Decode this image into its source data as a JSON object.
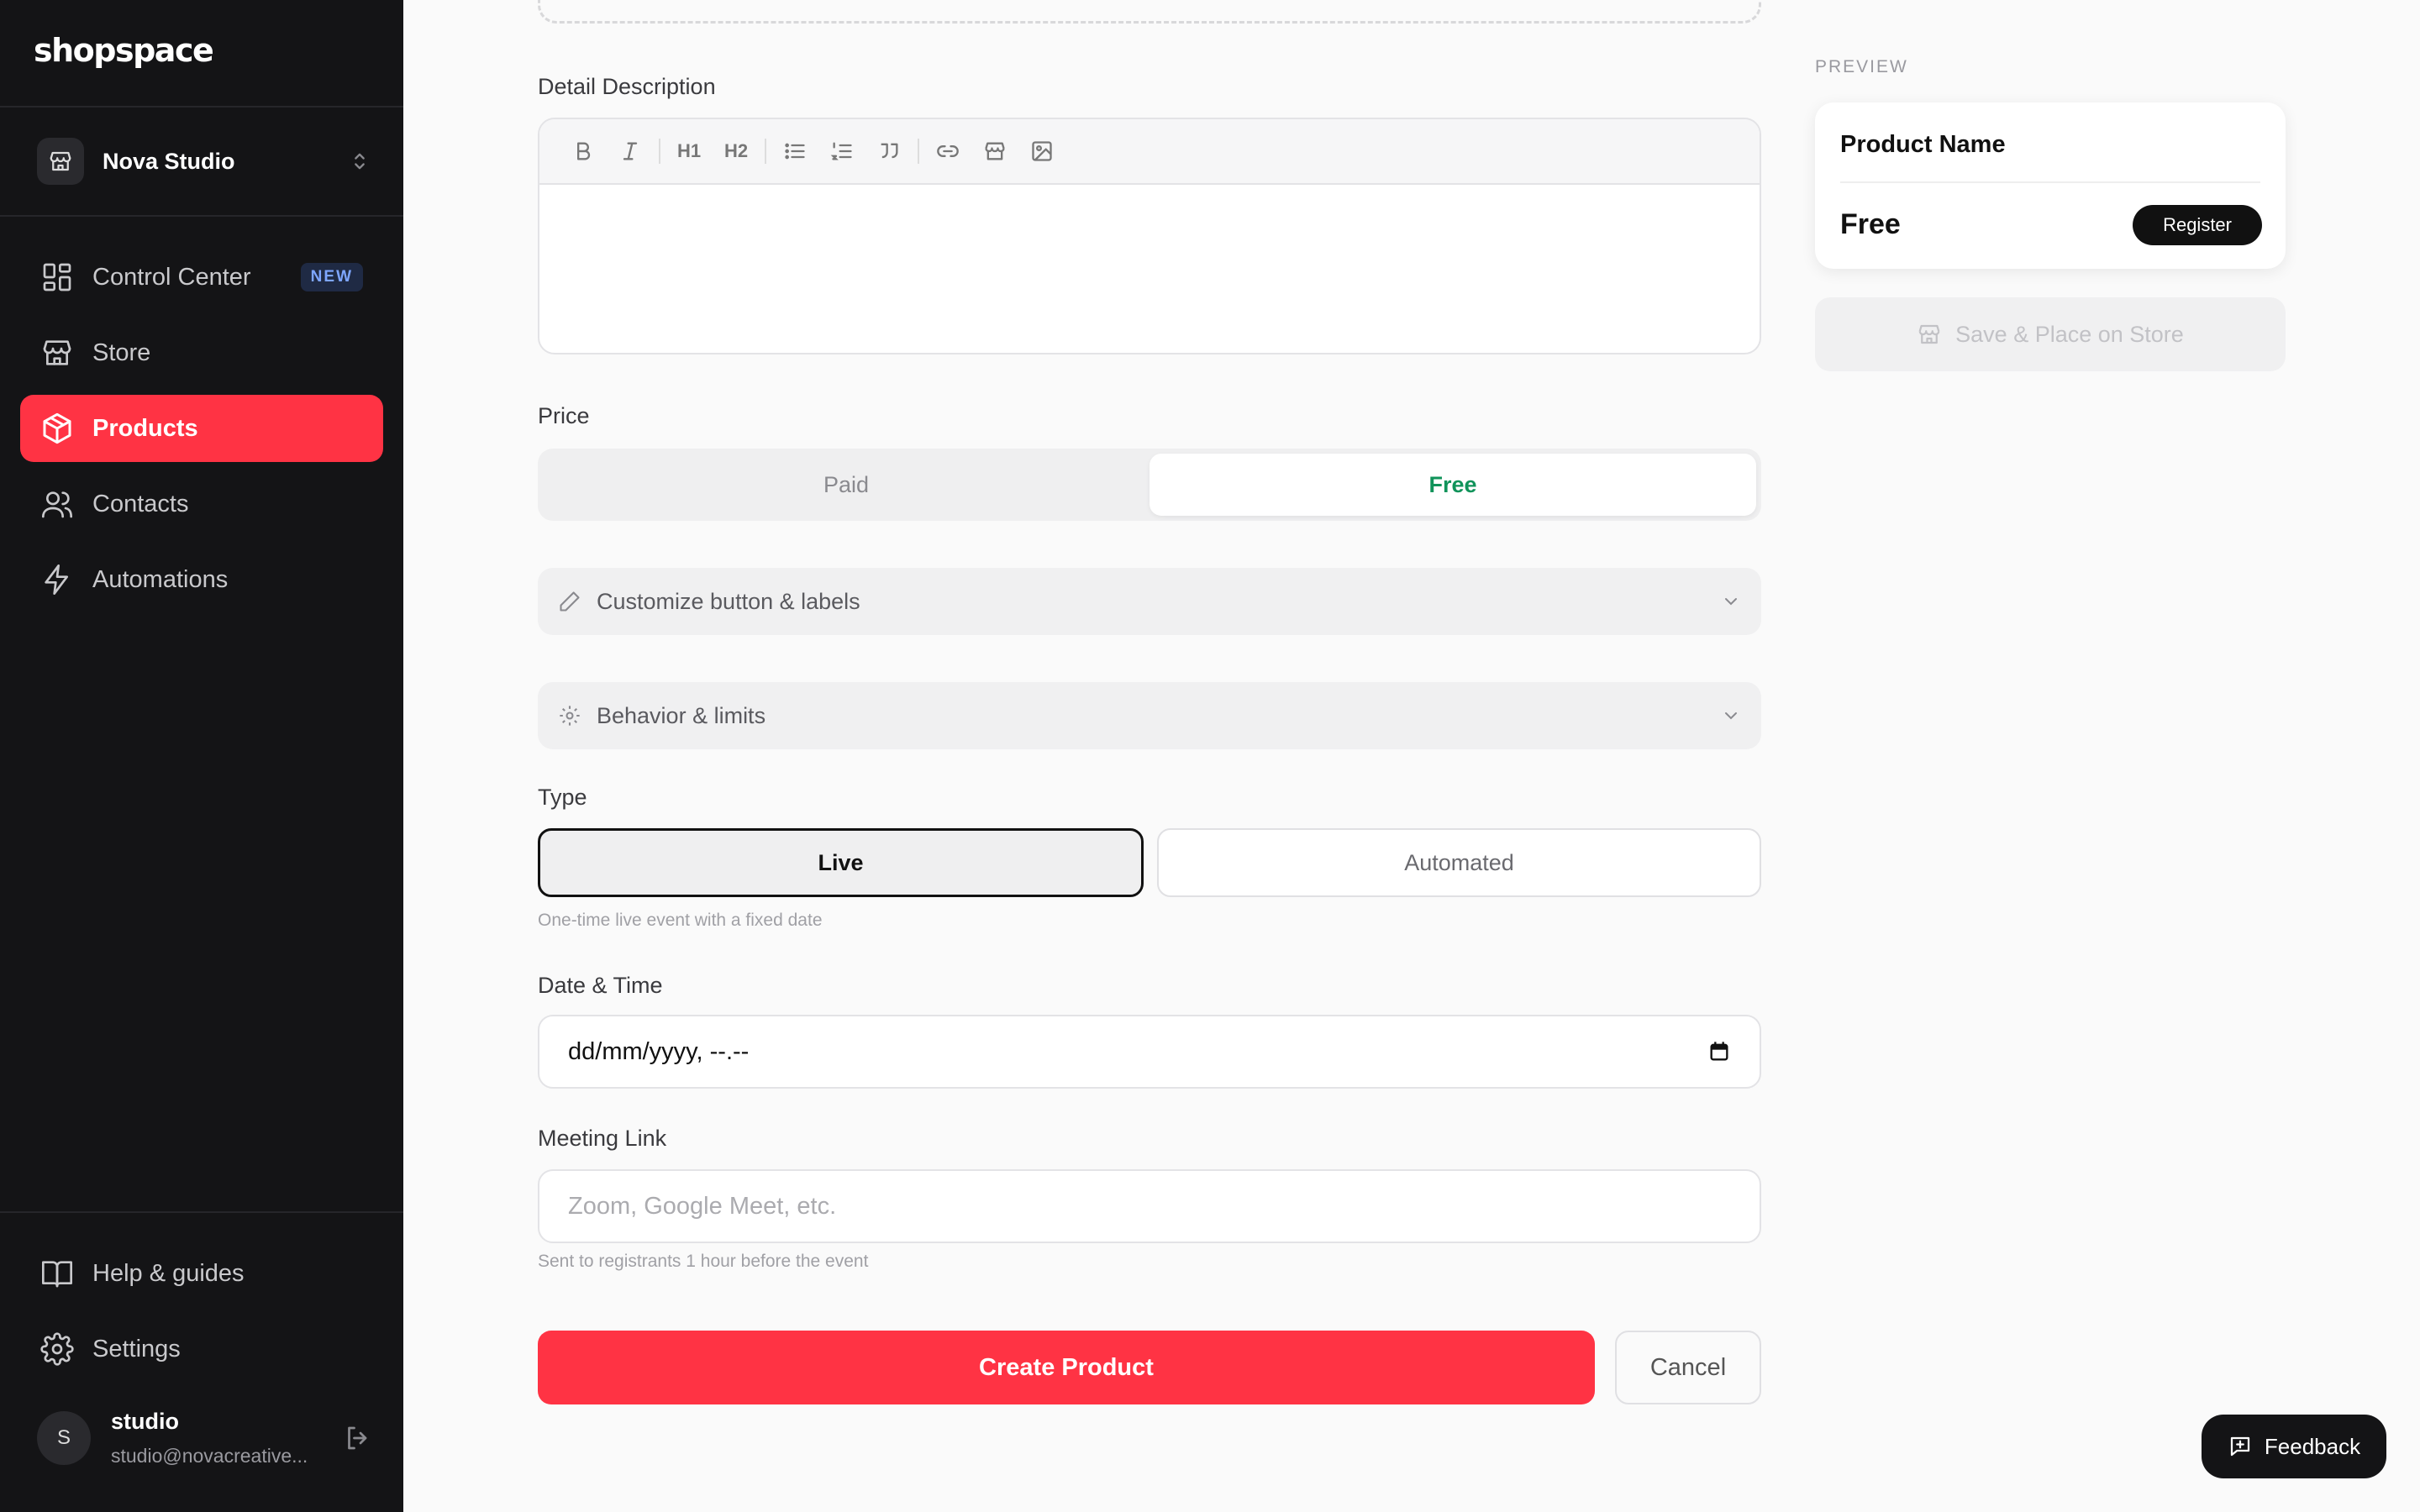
{
  "app": {
    "logo": "shopspace"
  },
  "workspace": {
    "name": "Nova Studio"
  },
  "nav": [
    {
      "label": "Control Center",
      "icon": "grid-icon",
      "badge": "NEW"
    },
    {
      "label": "Store",
      "icon": "store-icon"
    },
    {
      "label": "Products",
      "icon": "box-icon",
      "active": true
    },
    {
      "label": "Contacts",
      "icon": "users-icon"
    },
    {
      "label": "Automations",
      "icon": "bolt-icon"
    }
  ],
  "nav_bottom": [
    {
      "label": "Help & guides",
      "icon": "book-icon"
    },
    {
      "label": "Settings",
      "icon": "gear-icon"
    }
  ],
  "user": {
    "initial": "S",
    "name": "studio",
    "email": "studio@novacreative..."
  },
  "form": {
    "detail_label": "Detail Description",
    "toolbar": {
      "h1": "H1",
      "h2": "H2"
    },
    "price_label": "Price",
    "price_options": [
      "Paid",
      "Free"
    ],
    "price_selected": "Free",
    "customize_label": "Customize button & labels",
    "behavior_label": "Behavior & limits",
    "type_label": "Type",
    "type_options": [
      "Live",
      "Automated"
    ],
    "type_hint": "One-time live event with a fixed date",
    "datetime_label": "Date & Time",
    "datetime_value": "dd/mm/yyyy, --.--",
    "meeting_label": "Meeting Link",
    "meeting_placeholder": "Zoom, Google Meet, etc.",
    "meeting_hint": "Sent to registrants 1 hour before the event",
    "create_label": "Create Product",
    "cancel_label": "Cancel"
  },
  "preview": {
    "label": "PREVIEW",
    "product_name": "Product Name",
    "price": "Free",
    "register_label": "Register",
    "save_label": "Save & Place on Store"
  },
  "feedback_label": "Feedback",
  "colors": {
    "accent": "#ff3344",
    "free_green": "#10935a",
    "sidebar_bg": "#141416"
  }
}
